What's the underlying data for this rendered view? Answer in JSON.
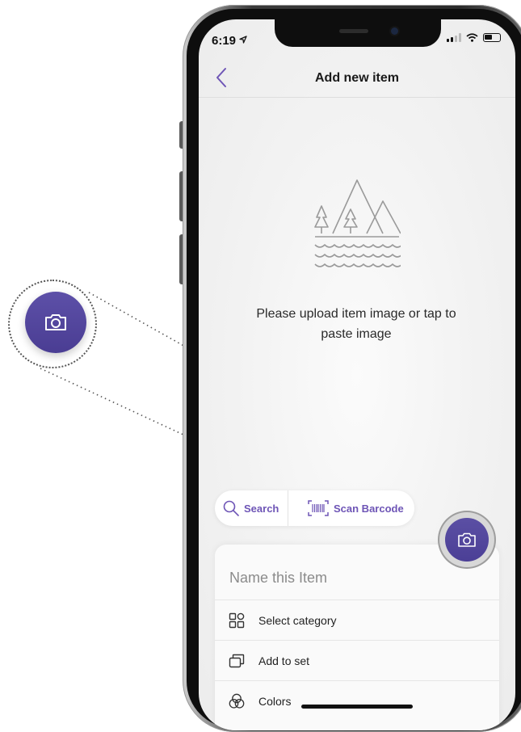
{
  "status_bar": {
    "time": "6:19",
    "icons": [
      "location-arrow-icon",
      "signal-icon",
      "wifi-icon",
      "battery-icon"
    ]
  },
  "nav": {
    "back_icon": "chevron-left-icon",
    "title": "Add new item"
  },
  "upload": {
    "illustration_icon": "mountains-landscape-icon",
    "hint": "Please upload item image or tap to paste image"
  },
  "search_pill": {
    "search_label": "Search",
    "search_icon": "search-icon",
    "scan_label": "Scan Barcode",
    "scan_icon": "barcode-icon"
  },
  "camera_button": {
    "icon": "camera-icon"
  },
  "sheet": {
    "name_placeholder": "Name this Item",
    "rows": [
      {
        "label": "Select category",
        "icon": "grid-icon"
      },
      {
        "label": "Add to set",
        "icon": "set-icon"
      },
      {
        "label": "Colors",
        "icon": "colors-icon"
      }
    ]
  },
  "colors": {
    "accent": "#6e55b6",
    "fab": "#4b3f96"
  }
}
